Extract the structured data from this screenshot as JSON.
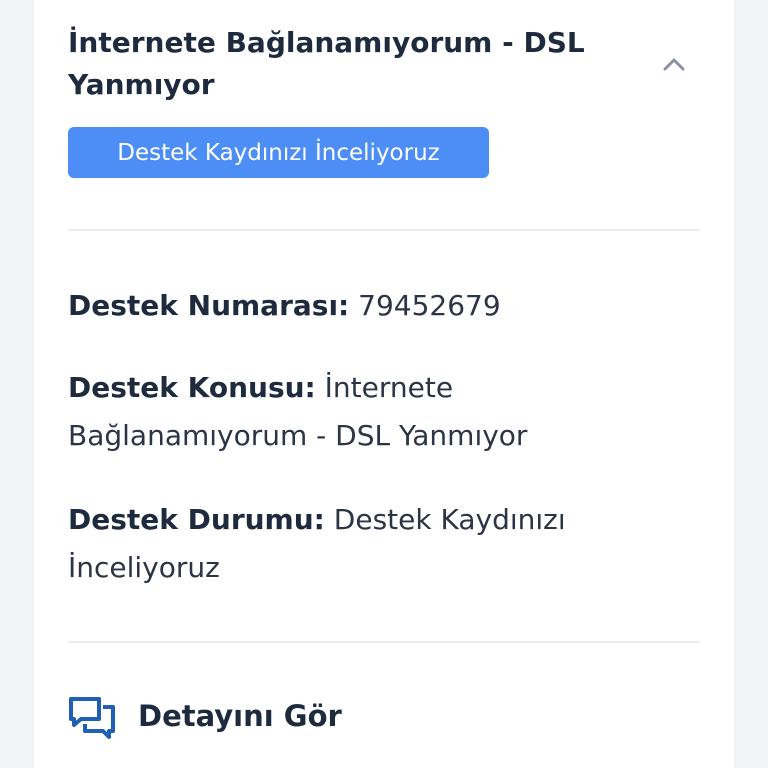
{
  "ticket": {
    "title": "İnternete Bağlanamıyorum - DSL Yanmıyor",
    "status_badge": "Destek Kaydınızı İnceliyoruz",
    "number_label": "Destek Numarası:",
    "number_value": "79452679",
    "subject_label": "Destek Konusu:",
    "subject_value": "İnternete Bağlanamıyorum - DSL Yanmıyor",
    "state_label": "Destek Durumu:",
    "state_value": "Destek Kaydınızı İnceliyoruz"
  },
  "actions": {
    "detail_label": "Detayını Gör"
  },
  "icons": {
    "collapse": "chevron-up-icon",
    "detail": "chat-bubbles-icon"
  },
  "colors": {
    "accent": "#4c8df6",
    "text_dark": "#1e2a3e",
    "icon_blue": "#1f5fb4"
  }
}
